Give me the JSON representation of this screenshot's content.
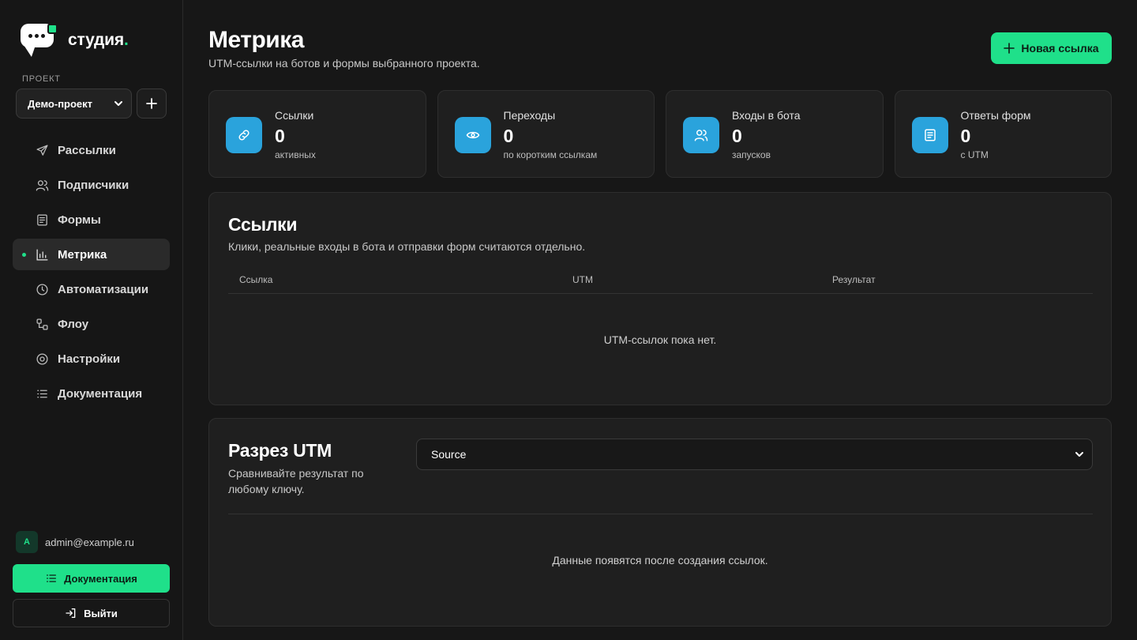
{
  "brand": {
    "name": "студия",
    "dot": ".",
    "accent": "#1fe08a",
    "info_color": "#2aa3dc"
  },
  "project": {
    "label": "ПРОЕКТ",
    "selected": "Демо-проект"
  },
  "nav": [
    {
      "label": "Рассылки",
      "icon": "send-icon",
      "active": false
    },
    {
      "label": "Подписчики",
      "icon": "users-icon",
      "active": false
    },
    {
      "label": "Формы",
      "icon": "form-icon",
      "active": false
    },
    {
      "label": "Метрика",
      "icon": "bar-chart-icon",
      "active": true
    },
    {
      "label": "Автоматизации",
      "icon": "clock-icon",
      "active": false
    },
    {
      "label": "Флоу",
      "icon": "flow-icon",
      "active": false
    },
    {
      "label": "Настройки",
      "icon": "settings-icon",
      "active": false
    },
    {
      "label": "Документация",
      "icon": "list-icon",
      "active": false
    }
  ],
  "user": {
    "avatar": "A",
    "email": "admin@example.ru"
  },
  "footer": {
    "docs_label": "Документация",
    "logout_label": "Выйти"
  },
  "header": {
    "title": "Метрика",
    "subtitle": "UTM-ссылки на ботов и формы выбранного проекта.",
    "new_link_label": "Новая ссылка"
  },
  "stats": [
    {
      "label": "Ссылки",
      "value": "0",
      "note": "активных",
      "icon": "link-icon"
    },
    {
      "label": "Переходы",
      "value": "0",
      "note": "по коротким ссылкам",
      "icon": "eye-icon"
    },
    {
      "label": "Входы в бота",
      "value": "0",
      "note": "запусков",
      "icon": "users-icon"
    },
    {
      "label": "Ответы форм",
      "value": "0",
      "note": "с UTM",
      "icon": "form-icon"
    }
  ],
  "links": {
    "title": "Ссылки",
    "subtitle": "Клики, реальные входы в бота и отправки форм считаются отдельно.",
    "columns": [
      "Ссылка",
      "UTM",
      "Результат"
    ],
    "empty": "UTM-ссылок пока нет."
  },
  "utm": {
    "title": "Разрез UTM",
    "subtitle": "Сравнивайте результат по любому ключу.",
    "selected": "Source",
    "empty": "Данные появятся после создания ссылок."
  }
}
